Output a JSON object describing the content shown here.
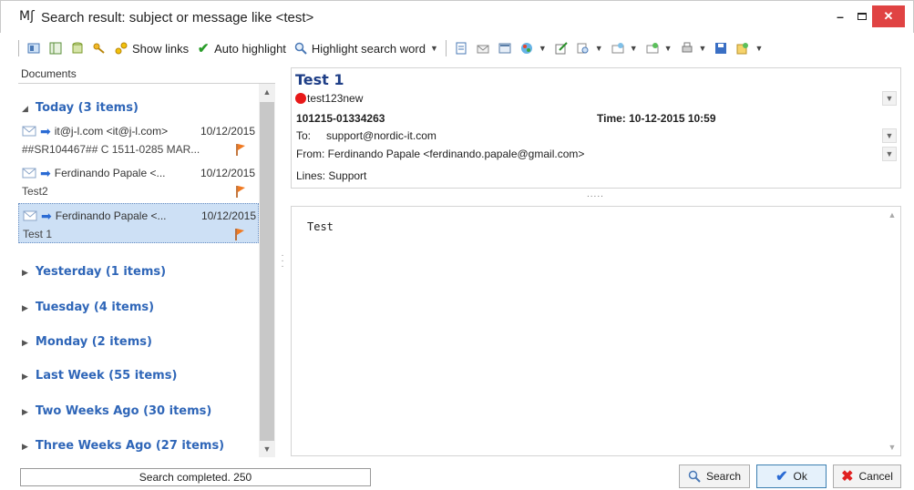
{
  "window": {
    "logo": "Mʃ",
    "title": "Search result: subject or message like <test>",
    "minimize": "–",
    "close": "✕"
  },
  "toolbar": {
    "show_links": "Show links",
    "auto_highlight": "Auto highlight",
    "highlight_search_word": "Highlight search word"
  },
  "left": {
    "header": "Documents",
    "groups": [
      {
        "label": "Today (3 items)",
        "expanded": true
      },
      {
        "label": "Yesterday (1 items)",
        "expanded": false
      },
      {
        "label": "Tuesday (4 items)",
        "expanded": false
      },
      {
        "label": "Monday (2 items)",
        "expanded": false
      },
      {
        "label": "Last Week (55 items)",
        "expanded": false
      },
      {
        "label": "Two Weeks Ago (30 items)",
        "expanded": false
      },
      {
        "label": "Three Weeks Ago (27 items)",
        "expanded": false
      }
    ],
    "items": [
      {
        "from": "it@j-l.com <it@j-l.com>",
        "date": "10/12/2015",
        "subject": "##SR104467## C 1511-0285 MAR...",
        "selected": false
      },
      {
        "from": "Ferdinando Papale <...",
        "date": "10/12/2015",
        "subject": "Test2",
        "selected": false
      },
      {
        "from": "Ferdinando Papale <...",
        "date": "10/12/2015",
        "subject": "Test 1",
        "selected": true
      }
    ]
  },
  "message": {
    "subject": "Test 1",
    "tag": "test123new",
    "id": "101215-01334263",
    "time": "Time:  10-12-2015 10:59",
    "to_label": "To:",
    "to_value": "support@nordic-it.com",
    "from": "From: Ferdinando Papale <ferdinando.papale@gmail.com>",
    "lines": "Lines: Support",
    "splitter": ".....",
    "body": "Test"
  },
  "status": {
    "text": "Search completed. 250"
  },
  "buttons": {
    "search": "Search",
    "ok": "Ok",
    "cancel": "Cancel"
  },
  "colors": {
    "accent": "#2f66b8",
    "selection": "#cde0f5",
    "close": "#e04343"
  }
}
